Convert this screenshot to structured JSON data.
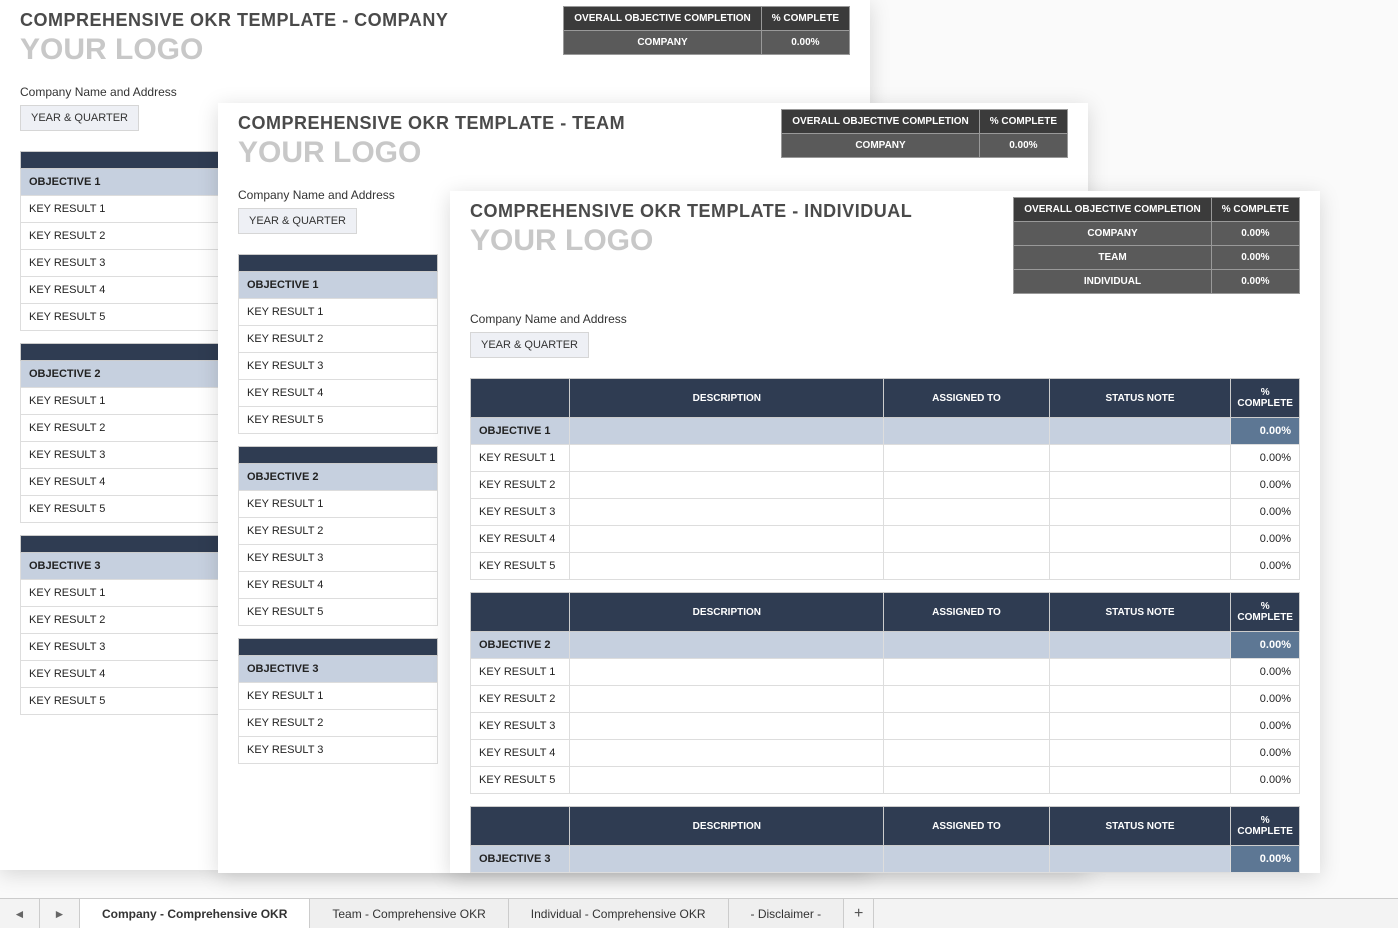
{
  "common": {
    "logo": "YOUR LOGO",
    "addr": "Company Name and Address",
    "yq": "YEAR & QUARTER",
    "overall": "OVERALL OBJECTIVE COMPLETION",
    "pctcomp": "% COMPLETE",
    "desc": "DESCRIPTION",
    "assigned": "ASSIGNED TO",
    "status": "STATUS NOTE",
    "zero": "0.00%",
    "obj": [
      "OBJECTIVE 1",
      "OBJECTIVE 2",
      "OBJECTIVE 3"
    ],
    "kr": [
      "KEY RESULT 1",
      "KEY RESULT 2",
      "KEY RESULT 3",
      "KEY RESULT 4",
      "KEY RESULT 5"
    ]
  },
  "company": {
    "title": "COMPREHENSIVE OKR TEMPLATE - COMPANY",
    "rows": [
      {
        "label": "COMPANY",
        "val": "0.00%"
      }
    ]
  },
  "team": {
    "title": "COMPREHENSIVE OKR TEMPLATE - TEAM",
    "rows": [
      {
        "label": "COMPANY",
        "val": "0.00%"
      }
    ]
  },
  "ind": {
    "title": "COMPREHENSIVE OKR TEMPLATE - INDIVIDUAL",
    "rows": [
      {
        "label": "COMPANY",
        "val": "0.00%"
      },
      {
        "label": "TEAM",
        "val": "0.00%"
      },
      {
        "label": "INDIVIDUAL",
        "val": "0.00%"
      }
    ]
  },
  "tabs": {
    "items": [
      {
        "label": "Company - Comprehensive OKR",
        "active": true
      },
      {
        "label": "Team - Comprehensive OKR",
        "active": false
      },
      {
        "label": "Individual - Comprehensive OKR",
        "active": false
      },
      {
        "label": "- Disclaimer -",
        "active": false
      }
    ]
  }
}
